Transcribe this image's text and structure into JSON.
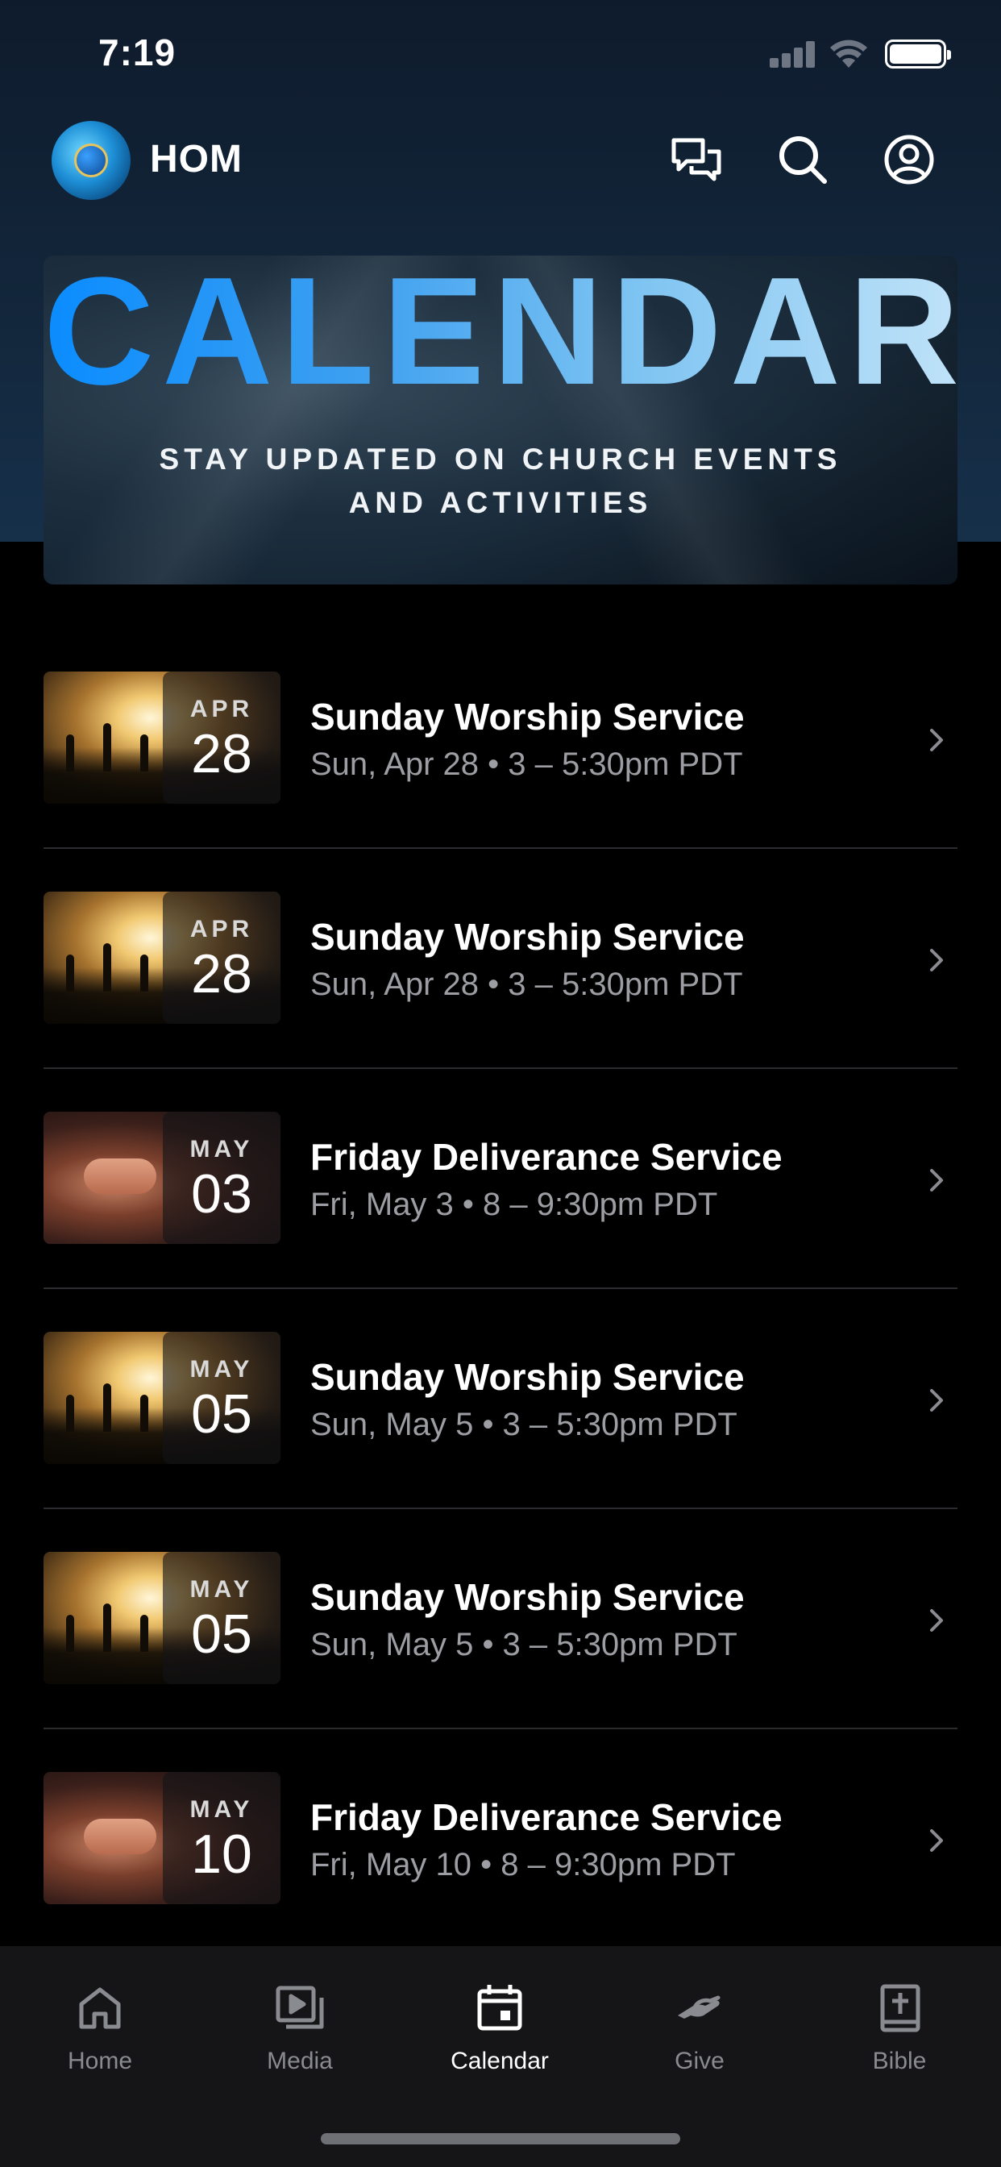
{
  "status_bar": {
    "time": "7:19"
  },
  "header": {
    "app_name": "HOM",
    "icons": [
      "chat-icon",
      "search-icon",
      "profile-icon"
    ]
  },
  "banner": {
    "title": "CALENDAR",
    "subtitle_line1": "STAY UPDATED ON CHURCH EVENTS",
    "subtitle_line2": "AND ACTIVITIES"
  },
  "events": [
    {
      "month": "APR",
      "day": "28",
      "title": "Sunday Worship Service",
      "subtitle": "Sun, Apr 28 • 3 – 5:30pm PDT",
      "image": "worship"
    },
    {
      "month": "APR",
      "day": "28",
      "title": "Sunday Worship Service",
      "subtitle": "Sun, Apr 28 • 3 – 5:30pm PDT",
      "image": "worship"
    },
    {
      "month": "MAY",
      "day": "03",
      "title": "Friday Deliverance Service",
      "subtitle": "Fri, May 3 • 8 – 9:30pm PDT",
      "image": "deliverance"
    },
    {
      "month": "MAY",
      "day": "05",
      "title": "Sunday Worship Service",
      "subtitle": "Sun, May 5 • 3 – 5:30pm PDT",
      "image": "worship"
    },
    {
      "month": "MAY",
      "day": "05",
      "title": "Sunday Worship Service",
      "subtitle": "Sun, May 5 • 3 – 5:30pm PDT",
      "image": "worship"
    },
    {
      "month": "MAY",
      "day": "10",
      "title": "Friday Deliverance Service",
      "subtitle": "Fri, May 10 • 8 – 9:30pm PDT",
      "image": "deliverance"
    }
  ],
  "tabbar": {
    "tabs": [
      {
        "label": "Home",
        "icon": "home-icon"
      },
      {
        "label": "Media",
        "icon": "media-icon"
      },
      {
        "label": "Calendar",
        "icon": "calendar-icon",
        "active": true
      },
      {
        "label": "Give",
        "icon": "give-icon"
      },
      {
        "label": "Bible",
        "icon": "bible-icon"
      }
    ]
  },
  "colors": {
    "accent": "#0a8cff",
    "background": "#000000",
    "header_bg": "#13273c",
    "muted_text": "#9c9ea3"
  }
}
